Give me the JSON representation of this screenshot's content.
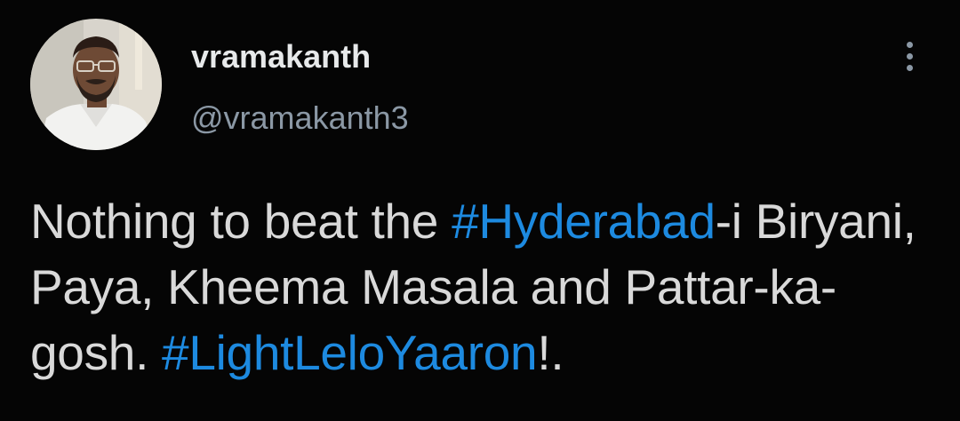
{
  "user": {
    "display_name": "vramakanth",
    "handle": "@vramakanth3",
    "avatar_alt": "profile photo"
  },
  "menu": {
    "icon": "more-vertical-icon"
  },
  "tweet": {
    "segments": [
      {
        "text": "Nothing to beat the ",
        "type": "text"
      },
      {
        "text": "#Hyderabad",
        "type": "hashtag"
      },
      {
        "text": "-i Biryani, Paya, Kheema Masala and Pattar-ka-gosh. ",
        "type": "text"
      },
      {
        "text": "#LightLeloYaaron",
        "type": "hashtag"
      },
      {
        "text": "!.",
        "type": "text"
      }
    ]
  },
  "colors": {
    "background": "#050505",
    "primary_text": "#e7e9ea",
    "body_text": "#d9d9d9",
    "secondary_text": "#8b98a5",
    "hashtag": "#1d8ae0"
  }
}
